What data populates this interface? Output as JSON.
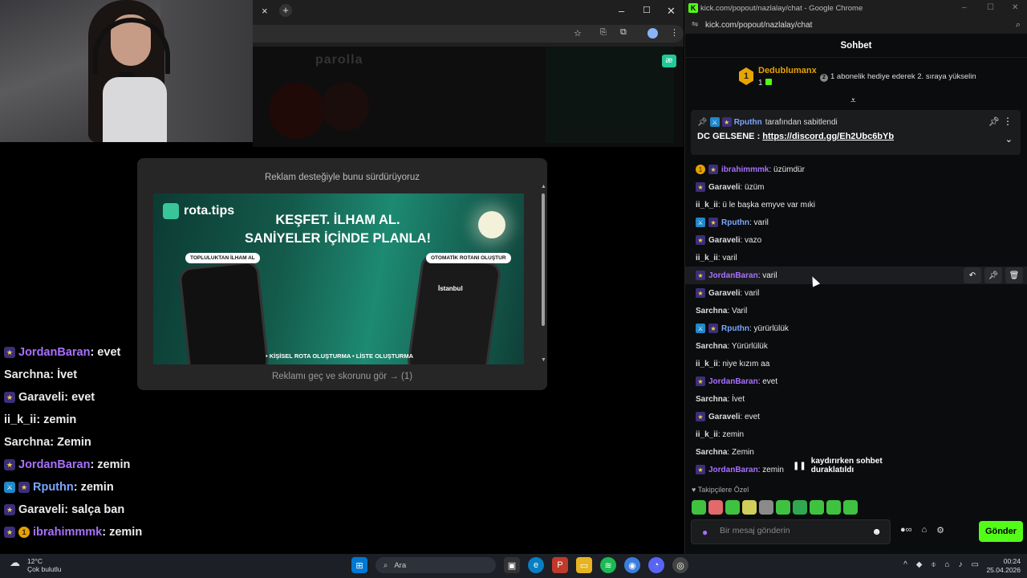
{
  "left_browser": {
    "tab_close": "×",
    "tab_new": "+",
    "window_controls": [
      "–",
      "☐",
      "✕"
    ],
    "toolbar_icons": [
      "star-icon",
      "translate-icon",
      "extensions-icon",
      "profile-icon",
      "menu-icon"
    ],
    "stream_logo": "parolla"
  },
  "ad_modal": {
    "title": "Reklam desteğiyle bunu sürdürüyoruz",
    "banner": {
      "brand": "rota.tips",
      "headline_1": "KEŞFET. İLHAM AL.",
      "headline_2": "SANİYELER İÇİNDE PLANLA!",
      "pill_left": "TOPLULUKTAN İLHAM AL",
      "pill_right": "OTOMATİK ROTANI OLUŞTUR",
      "city": "İstanbul",
      "footer": "• KİŞİSEL ROTA OLUŞTURMA  • LİSTE OLUŞTURMA"
    },
    "skip_text": "Reklamı geç ve skorunu gör → (1)"
  },
  "overlay_chat": [
    {
      "badges": [
        "star"
      ],
      "user": "JordanBaran",
      "color": "#a970ff",
      "text": " : evet"
    },
    {
      "badges": [],
      "user": "Sarchna",
      "color": "#e8e8e8",
      "text": " : İvet"
    },
    {
      "badges": [
        "star"
      ],
      "user": "Garaveli",
      "color": "#e8e8e8",
      "text": " : evet"
    },
    {
      "badges": [],
      "user": "ii_k_ii",
      "color": "#e8e8e8",
      "text": " : zemin"
    },
    {
      "badges": [],
      "user": "Sarchna",
      "color": "#e8e8e8",
      "text": " : Zemin"
    },
    {
      "badges": [
        "star"
      ],
      "user": "JordanBaran",
      "color": "#a970ff",
      "text": " : zemin"
    },
    {
      "badges": [
        "mod",
        "star"
      ],
      "user": "Rputhn",
      "color": "#7aa7ff",
      "text": " : zemin"
    },
    {
      "badges": [
        "star"
      ],
      "user": "Garaveli",
      "color": "#e8e8e8",
      "text": " : salça ban"
    },
    {
      "badges": [
        "star",
        "gold"
      ],
      "user": "ibrahimmmk",
      "color": "#a970ff",
      "text": " : zemin"
    }
  ],
  "chat_window": {
    "title": "kick.com/popout/nazlalay/chat - Google Chrome",
    "url": "kick.com/popout/nazlalay/chat",
    "header": "Sohbet",
    "leader": {
      "rank": "1",
      "name": "Dedublumanx",
      "count": "1",
      "message_rank": "2",
      "message": "1 abonelik hediye ederek 2. sıraya yükselin"
    },
    "pinned": {
      "by_user": "Rputhn",
      "by_text": "tarafından sabitlendi",
      "prefix": "DC GELSENE : ",
      "link": "https://discord.gg/Eh2Ubc6bYb"
    },
    "messages": [
      {
        "badges": [
          "gold",
          "star"
        ],
        "user": "ibrahimmmk",
        "cls": "c-purple",
        "text": ": üzümdür"
      },
      {
        "badges": [
          "star"
        ],
        "user": "Garaveli",
        "cls": "c-white",
        "text": ": üzüm"
      },
      {
        "badges": [],
        "user": "ii_k_ii",
        "cls": "c-white",
        "text": ": ü le başka emyve var mıki"
      },
      {
        "badges": [
          "mod",
          "star"
        ],
        "user": "Rputhn",
        "cls": "c-blue",
        "text": ": varil"
      },
      {
        "badges": [
          "star"
        ],
        "user": "Garaveli",
        "cls": "c-white",
        "text": ": vazo"
      },
      {
        "badges": [],
        "user": "ii_k_ii",
        "cls": "c-white",
        "text": ": varil"
      },
      {
        "badges": [
          "star"
        ],
        "user": "JordanBaran",
        "cls": "c-purple",
        "text": ": varil",
        "highlight": true
      },
      {
        "badges": [
          "star"
        ],
        "user": "Garaveli",
        "cls": "c-white",
        "text": ": varil"
      },
      {
        "badges": [],
        "user": "Sarchna",
        "cls": "c-white",
        "text": ": Varil"
      },
      {
        "badges": [
          "mod",
          "star"
        ],
        "user": "Rputhn",
        "cls": "c-blue",
        "text": ": yürürlülük"
      },
      {
        "badges": [],
        "user": "Sarchna",
        "cls": "c-white",
        "text": ": Yürürlülük"
      },
      {
        "badges": [],
        "user": "ii_k_ii",
        "cls": "c-white",
        "text": ": niye kızım aa"
      },
      {
        "badges": [
          "star"
        ],
        "user": "JordanBaran",
        "cls": "c-purple",
        "text": ": evet"
      },
      {
        "badges": [],
        "user": "Sarchna",
        "cls": "c-white",
        "text": ": İvet"
      },
      {
        "badges": [
          "star"
        ],
        "user": "Garaveli",
        "cls": "c-white",
        "text": ": evet"
      },
      {
        "badges": [],
        "user": "ii_k_ii",
        "cls": "c-white",
        "text": ": zemin"
      },
      {
        "badges": [],
        "user": "Sarchna",
        "cls": "c-white",
        "text": ": Zemin"
      },
      {
        "badges": [
          "star"
        ],
        "user": "JordanBaran",
        "cls": "c-purple",
        "text": ": zemin"
      }
    ],
    "paused_notice": "kaydırırken sohbet duraklatıldı",
    "followers_label": "Takipçilere Özel",
    "emotes": [
      "frog-emote",
      "blob-emote",
      "sunglasses-emote",
      "skull-emote",
      "cat-emote",
      "money-emote",
      "pepe-emote",
      "alien-emote",
      "grin-emote",
      "smile-emote"
    ],
    "input_placeholder": "Bir mesaj gönderin",
    "send_label": "Gönder"
  },
  "taskbar": {
    "temp": "12°C",
    "weather": "Çok bulutlu",
    "search_label": "Ara",
    "time": "00:24",
    "date": "25.04.2026"
  },
  "colors": {
    "kick_green": "#53fc18",
    "purple_user": "#a970ff",
    "blue_user": "#7aa7ff",
    "gold": "#e6a100"
  }
}
